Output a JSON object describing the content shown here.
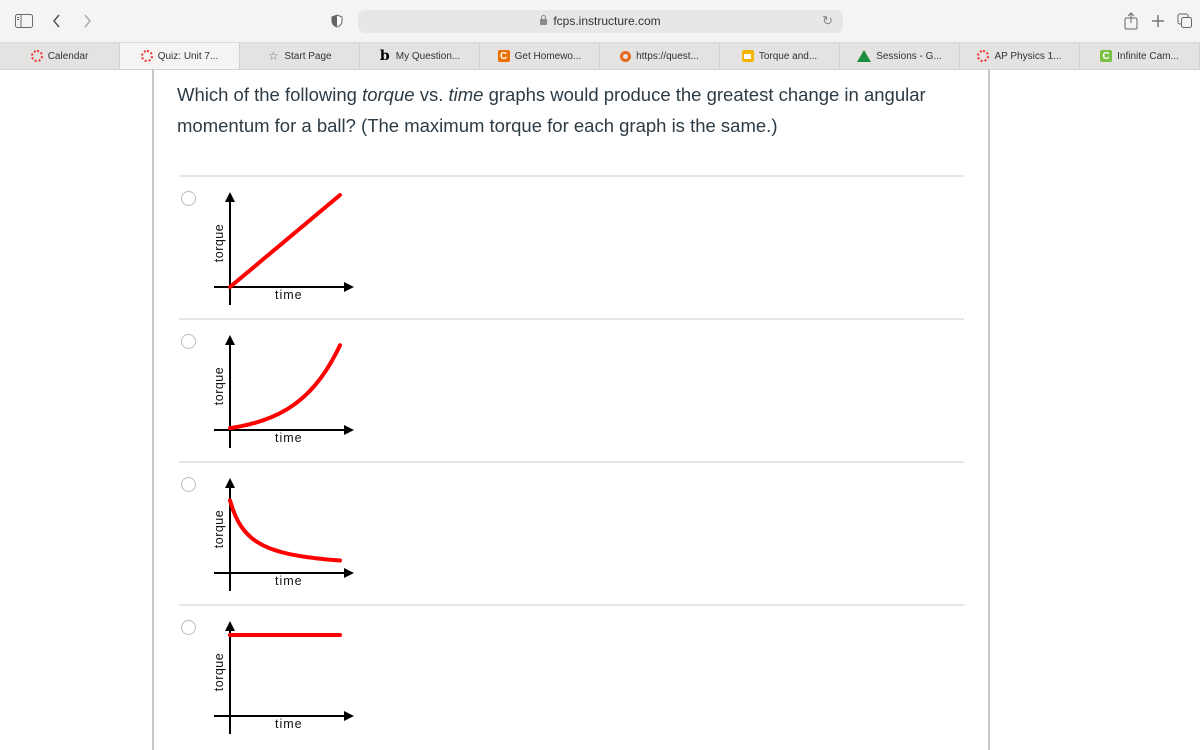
{
  "browser": {
    "url": "fcps.instructure.com",
    "icons": [
      "sidebar-icon",
      "back-icon",
      "forward-icon",
      "privacy-shield-icon",
      "lock-icon",
      "reload-icon",
      "share-icon",
      "new-tab-icon",
      "tab-overview-icon"
    ],
    "tabs": [
      {
        "label": "Calendar",
        "favicon": "canvas",
        "active": false
      },
      {
        "label": "Quiz: Unit 7...",
        "favicon": "canvas",
        "active": true
      },
      {
        "label": "Start Page",
        "favicon": "star",
        "active": false
      },
      {
        "label": "My Question...",
        "favicon": "bartleby",
        "active": false
      },
      {
        "label": "Get Homewo...",
        "favicon": "chegg",
        "active": false
      },
      {
        "label": "https://quest...",
        "favicon": "quest",
        "active": false
      },
      {
        "label": "Torque and...",
        "favicon": "slides",
        "active": false
      },
      {
        "label": "Sessions - G...",
        "favicon": "drive",
        "active": false
      },
      {
        "label": "AP Physics 1...",
        "favicon": "canvas",
        "active": false
      },
      {
        "label": "Infinite Cam...",
        "favicon": "infinite",
        "active": false
      }
    ]
  },
  "question": {
    "part1": "Which of the following ",
    "em1": "torque",
    "part2": " vs. ",
    "em2": "time",
    "part3": " graphs would produce the greatest change in angular momentum for a ball? (The maximum torque for each graph is the same.)"
  },
  "answers": [
    {
      "ylabel": "torque",
      "xlabel": "time",
      "curve": "linear-increasing",
      "selected": false
    },
    {
      "ylabel": "torque",
      "xlabel": "time",
      "curve": "exponential-increasing",
      "selected": false
    },
    {
      "ylabel": "torque",
      "xlabel": "time",
      "curve": "decaying",
      "selected": false
    },
    {
      "ylabel": "torque",
      "xlabel": "time",
      "curve": "constant-max",
      "selected": false
    }
  ],
  "colors": {
    "curve": "#ff0000",
    "axis": "#000000",
    "text": "#2d3b45"
  }
}
